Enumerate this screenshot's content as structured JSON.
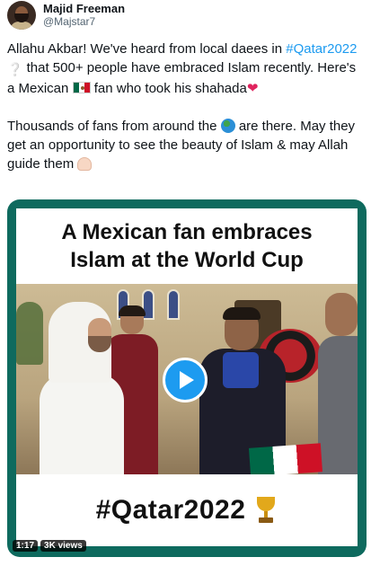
{
  "author": {
    "display_name": "Majid Freeman",
    "handle": "@Majstar7"
  },
  "tweet": {
    "p1_part1": "Allahu Akbar! We've heard from local daees in",
    "p1_hashtag": "#Qatar2022",
    "p1_part2": "that 500+ people have embraced Islam recently. Here's a Mexican",
    "p1_part3": "fan who took his shahada",
    "p2_part1": "Thousands of fans from around the",
    "p2_part2": "are there. May they get an opportunity to see the beauty of Islam & may Allah guide them",
    "emojis": [
      "question-mark-icon",
      "mexico-flag-icon",
      "red-heart-icon",
      "globe-icon",
      "praying-hands-icon"
    ]
  },
  "media": {
    "headline_line1": "A Mexican fan embraces",
    "headline_line2": "Islam at the World Cup",
    "bottom_tag": "#Qatar2022",
    "duration": "1:17",
    "views": "3K views",
    "frame_color": "#0e6a5e",
    "play_color": "#1d9bf0"
  }
}
